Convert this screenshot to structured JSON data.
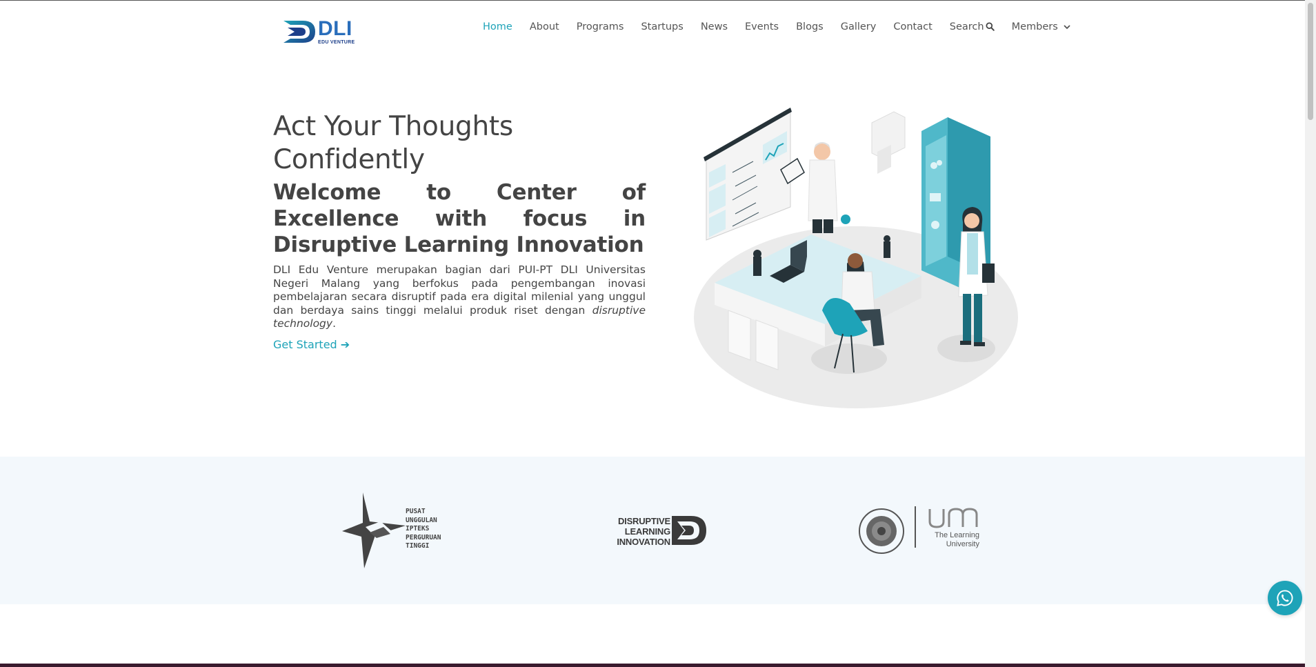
{
  "header": {
    "logo": {
      "text": "DLI",
      "subtext": "EDU VENTURE"
    },
    "nav": [
      {
        "label": "Home",
        "active": true
      },
      {
        "label": "About"
      },
      {
        "label": "Programs"
      },
      {
        "label": "Startups"
      },
      {
        "label": "News"
      },
      {
        "label": "Events"
      },
      {
        "label": "Blogs"
      },
      {
        "label": "Gallery"
      },
      {
        "label": "Contact"
      }
    ],
    "search": {
      "label": "Search",
      "icon": "search-icon"
    },
    "members": {
      "label": "Members",
      "icon": "chevron-down-icon"
    }
  },
  "hero": {
    "title": "Act Your Thoughts Confidently",
    "subtitle": "Welcome to Center of Excellence with focus in Disruptive Learning Innovation",
    "description_main": "DLI Edu Venture merupakan bagian dari PUI-PT DLI Universitas Negeri Malang yang berfokus pada pengembangan inovasi pembelajaran secara disruptif pada era digital milenial yang unggul dan berdaya sains tinggi melalui produk riset dengan ",
    "description_em": "disruptive technology",
    "description_end": ".",
    "cta": "Get Started ➔",
    "illustration": "laboratory-illustration"
  },
  "partners": [
    {
      "name": "pui-pt-logo",
      "text": "PUSAT\nUNGGULAN\nIPTEKS\nPERGURUAN\nTINGGI"
    },
    {
      "name": "dli-logo",
      "text": "DISRUPTIVE\nLEARNING\nINNOVATION"
    },
    {
      "name": "um-logo",
      "text": "The Learning\nUniversity",
      "mark": "um"
    }
  ],
  "whatsapp": {
    "icon": "whatsapp-icon"
  },
  "colors": {
    "accent": "#1ea3b8",
    "band": "#f3f8fc",
    "text": "#444444"
  }
}
